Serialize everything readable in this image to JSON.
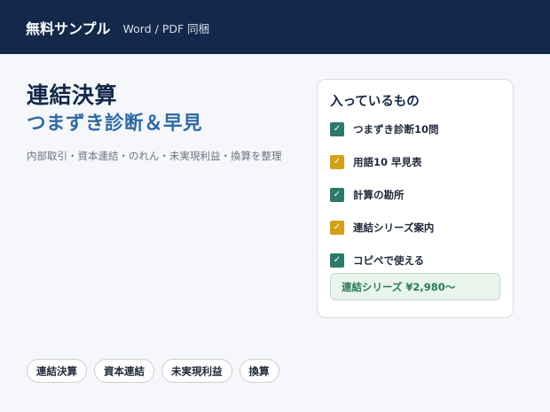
{
  "header": {
    "brand": "無料サンプル",
    "subtitle": "Word / PDF 同梱",
    "background_color": "#13284a"
  },
  "hero": {
    "title_line1": "連結決算",
    "title_line2": "つまずき診断＆早見",
    "description": "内部取引・資本連結・のれん・未実現利益・換算を整理",
    "title_color": "#13284a",
    "accent_color": "#2f6aa6"
  },
  "contents_card": {
    "title": "入っているもの",
    "items": [
      {
        "label": "つまずき診断10問",
        "checked": true,
        "color": "#2c7a6a"
      },
      {
        "label": "用語10 早見表",
        "checked": true,
        "color": "#d4a017"
      },
      {
        "label": "計算の勘所",
        "checked": true,
        "color": "#2c7a6a"
      },
      {
        "label": "連結シリーズ案内",
        "checked": true,
        "color": "#d4a017"
      },
      {
        "label": "コピペで使える",
        "checked": true,
        "color": "#2c7a6a"
      }
    ],
    "series_price": "連結シリーズ ¥2,980〜"
  },
  "tags": [
    "連結決算",
    "資本連結",
    "未実現利益",
    "換算"
  ]
}
